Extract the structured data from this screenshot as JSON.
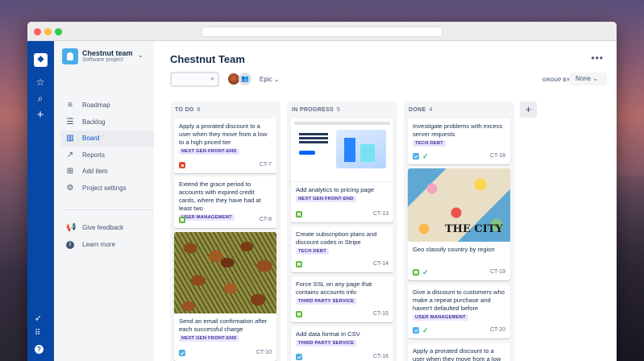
{
  "project": {
    "name": "Chestnut team",
    "type": "Software project"
  },
  "nav": [
    {
      "label": "Roadmap",
      "icon": "roadmap-icon"
    },
    {
      "label": "Backlog",
      "icon": "backlog-icon"
    },
    {
      "label": "Board",
      "icon": "board-icon"
    },
    {
      "label": "Reports",
      "icon": "reports-icon"
    },
    {
      "label": "Add item",
      "icon": "add-item-icon"
    },
    {
      "label": "Project settings",
      "icon": "settings-icon"
    }
  ],
  "secondary": [
    {
      "label": "Give feedback"
    },
    {
      "label": "Learn more"
    }
  ],
  "page": {
    "title": "Chestnut Team",
    "epic": "Epic",
    "group_by": "GROUP BY",
    "group_value": "None"
  },
  "columns": [
    {
      "title": "TO DO",
      "count": "6"
    },
    {
      "title": "IN PROGRESS",
      "count": "5"
    },
    {
      "title": "DONE",
      "count": "4"
    }
  ],
  "cards": {
    "todo": [
      {
        "text": "Apply a prorated discount to a user when they move from a low to a high priced tier",
        "tag": "NEXT GEN FRONT-END",
        "id": "CT-7",
        "type": "bug"
      },
      {
        "text": "Extend the grace period to accounts with expired credit cards, where they have had at least two",
        "tag": "USER MANAGEMENT",
        "id": "CT-8",
        "type": "story"
      },
      {
        "text": "Send an email confirmation after each successful charge",
        "tag": "NEXT GEN FRONT-END",
        "id": "CT-10",
        "type": "task"
      }
    ],
    "progress": [
      {
        "text": "Add analytics to pricing page",
        "tag": "NEXT GEN FRONT-END",
        "id": "CT-13",
        "type": "story"
      },
      {
        "text": "Create subscription plans and discount codes in Stripe",
        "tag": "TECH DEBT",
        "id": "CT-14",
        "type": "story"
      },
      {
        "text": "Force SSL on any page that contains accounts info",
        "tag": "THIRD PARTY SERVICE",
        "id": "CT-15",
        "type": "story"
      },
      {
        "text": "Add data format in CSV",
        "tag": "THIRD PARTY SERVICE",
        "id": "CT-16",
        "type": "task"
      }
    ],
    "done": [
      {
        "text": "Investigate problems with excess server requests",
        "tag": "TECH DEBT",
        "id": "CT-18",
        "type": "task"
      },
      {
        "text": "Geo classify country by region",
        "tag": "",
        "id": "CT-19",
        "type": "story"
      },
      {
        "text": "Give a discount to customers who make a repeat purchase and haven't defaulted before",
        "tag": "USER MANAGEMENT",
        "id": "CT-20",
        "type": "task"
      },
      {
        "text": "Apply a prorated discount to a user when they move from a low to a",
        "tag": "",
        "id": "",
        "type": ""
      }
    ]
  },
  "image_text": {
    "city": "THE CITY"
  }
}
